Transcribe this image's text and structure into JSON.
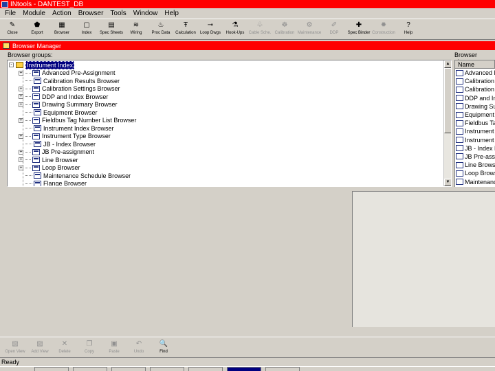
{
  "window": {
    "title": "INtools - DANTEST_DB"
  },
  "menu": [
    "File",
    "Module",
    "Action",
    "Browser",
    "Tools",
    "Window",
    "Help"
  ],
  "toolbar": [
    {
      "label": "Close",
      "icon": "close-icon",
      "glyph": "✎",
      "enabled": true
    },
    {
      "label": "Export",
      "icon": "export-icon",
      "glyph": "⬟",
      "enabled": true
    },
    {
      "label": "Browser",
      "icon": "browser-icon",
      "glyph": "▦",
      "enabled": true
    },
    {
      "label": "Index",
      "icon": "index-icon",
      "glyph": "▢",
      "enabled": true
    },
    {
      "label": "Spec Sheets",
      "icon": "spec-sheets-icon",
      "glyph": "▤",
      "enabled": true
    },
    {
      "label": "Wiring",
      "icon": "wiring-icon",
      "glyph": "≋",
      "enabled": true
    },
    {
      "label": "Proc Data",
      "icon": "process-data-icon",
      "glyph": "♨",
      "enabled": true
    },
    {
      "label": "Calculation",
      "icon": "calculation-icon",
      "glyph": "Ŧ",
      "enabled": true
    },
    {
      "label": "Loop Dwgs",
      "icon": "loop-drawings-icon",
      "glyph": "⊸",
      "enabled": true
    },
    {
      "label": "Hook-Ups",
      "icon": "hook-ups-icon",
      "glyph": "⚗",
      "enabled": true
    },
    {
      "label": "Cable Sche.",
      "icon": "cable-schedule-icon",
      "glyph": "♧",
      "enabled": false
    },
    {
      "label": "Calibration",
      "icon": "calibration-icon",
      "glyph": "☸",
      "enabled": false
    },
    {
      "label": "Maintenance",
      "icon": "maintenance-icon",
      "glyph": "⚙",
      "enabled": false
    },
    {
      "label": "DDP",
      "icon": "ddp-icon",
      "glyph": "✐",
      "enabled": false
    },
    {
      "label": "Spec Binder",
      "icon": "spec-binder-icon",
      "glyph": "✚",
      "enabled": true
    },
    {
      "label": "Construction",
      "icon": "construction-icon",
      "glyph": "✹",
      "enabled": false
    },
    {
      "label": "Help",
      "icon": "help-icon",
      "glyph": "?",
      "enabled": true
    }
  ],
  "browser_manager": {
    "title": "Browser Manager",
    "groups_label": "Browser groups:",
    "tree": [
      {
        "label": "Instrument Index",
        "root": true,
        "expander": "-"
      },
      {
        "label": "Advanced Pre-Assignment",
        "expander": "+"
      },
      {
        "label": "Calibration Results Browser",
        "expander": ""
      },
      {
        "label": "Calibration Settings Browser",
        "expander": "+"
      },
      {
        "label": "DDP and Index Browser",
        "expander": "+"
      },
      {
        "label": "Drawing Summary Browser",
        "expander": "+"
      },
      {
        "label": "Equipment Browser",
        "expander": ""
      },
      {
        "label": "Fieldbus Tag Number List Browser",
        "expander": "+"
      },
      {
        "label": "Instrument Index Browser",
        "expander": ""
      },
      {
        "label": "Instrument Type Browser",
        "expander": "+"
      },
      {
        "label": "JB - Index Browser",
        "expander": ""
      },
      {
        "label": "JB Pre-assignment",
        "expander": "+"
      },
      {
        "label": "Line Browser",
        "expander": "+"
      },
      {
        "label": "Loop Browser",
        "expander": "+"
      },
      {
        "label": "Maintenance Schedule Browser",
        "expander": ""
      },
      {
        "label": "Flange Browser",
        "expander": ""
      }
    ],
    "views_label": "Browser views:",
    "views_header": "Name",
    "views": [
      "Advanced P",
      "Calibration R",
      "Calibration S",
      "DDP and Ind",
      "Drawing Sum",
      "Equipment B",
      "Fieldbus Tag",
      "Instrument In",
      "Instrument Ty",
      "JB - Index B",
      "JB Pre-assig",
      "Line Browser",
      "Loop Brows",
      "Maintenance"
    ]
  },
  "bottom_toolbar": [
    {
      "label": "Open View",
      "icon": "open-view-icon",
      "glyph": "▧",
      "active": false
    },
    {
      "label": "Add View",
      "icon": "add-view-icon",
      "glyph": "▨",
      "active": false
    },
    {
      "label": "Delete",
      "icon": "delete-icon",
      "glyph": "✕",
      "active": false
    },
    {
      "label": "Copy",
      "icon": "copy-icon",
      "glyph": "❐",
      "active": false
    },
    {
      "label": "Paste",
      "icon": "paste-icon",
      "glyph": "▣",
      "active": false
    },
    {
      "label": "Undo",
      "icon": "undo-icon",
      "glyph": "↶",
      "active": false
    },
    {
      "label": "Find",
      "icon": "find-icon",
      "glyph": "🔍",
      "active": true
    }
  ],
  "status": {
    "text": "Ready"
  },
  "colors": {
    "titlebar": "#ff0000",
    "selection": "#000080",
    "face": "#d4d0c8"
  }
}
